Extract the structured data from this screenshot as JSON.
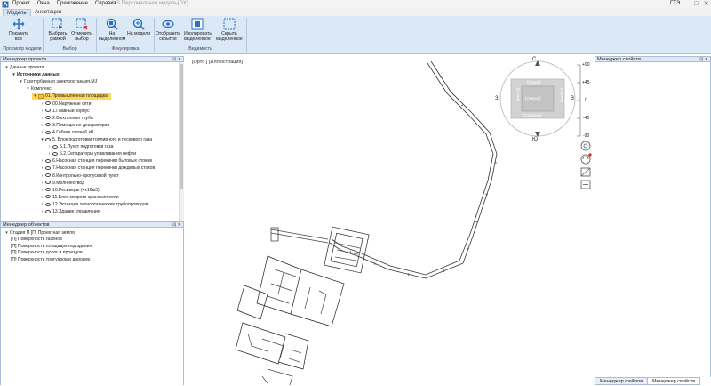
{
  "titlebar": {
    "menu": [
      "Проект",
      "Окна",
      "Приложение",
      "Справка"
    ],
    "app_title": "MS Персональная модель(DX)",
    "user": "ГТЭ",
    "min": "–",
    "max": "□",
    "close": "✕"
  },
  "ribbon_tabs": [
    "Модель",
    "Аннотации"
  ],
  "ribbon": {
    "buttons": [
      {
        "label": "Показать все",
        "icon": "show-all-icon"
      },
      {
        "label": "Выбрать рамкой",
        "icon": "select-frame-icon"
      },
      {
        "label": "Отменить выбор",
        "icon": "deselect-icon"
      },
      {
        "label": "На выделенном",
        "icon": "zoom-selected-icon"
      },
      {
        "label": "На модели",
        "icon": "zoom-model-icon"
      },
      {
        "label": "Отобразить скрытое",
        "icon": "show-hidden-icon"
      },
      {
        "label": "Изолировать выделенное",
        "icon": "isolate-icon"
      },
      {
        "label": "Скрыть выделенное",
        "icon": "hide-selected-icon"
      }
    ],
    "groups": [
      "Просмотр модели",
      "Выбор",
      "Фокусировка",
      "Видимость"
    ]
  },
  "project_manager": {
    "title": "Менеджер проекта",
    "tree": [
      {
        "label": "Данные проекта",
        "depth": 0,
        "toggle": "▾"
      },
      {
        "label": "Источники данных",
        "depth": 1,
        "toggle": "▾",
        "bold": true
      },
      {
        "label": "Газотурбинная электростанция.MJ",
        "depth": 2,
        "toggle": "▾"
      },
      {
        "label": "Комплекс",
        "depth": 3,
        "toggle": "▾"
      },
      {
        "label": "01.Промышленная площадка",
        "depth": 4,
        "toggle": "▾",
        "selected": true
      },
      {
        "label": "00.Наружные сети",
        "depth": 5,
        "toggle": "›"
      },
      {
        "label": "1.Главный корпус",
        "depth": 5,
        "toggle": "›"
      },
      {
        "label": "2.Выхлопная труба",
        "depth": 5,
        "toggle": "›"
      },
      {
        "label": "3.Помещение деаэраторов",
        "depth": 5,
        "toggle": "›"
      },
      {
        "label": "4.Гибкие связи 6 кВ",
        "depth": 5,
        "toggle": "›"
      },
      {
        "label": "5. Блок подготовки топливного и пускового газа",
        "depth": 5,
        "toggle": "▾"
      },
      {
        "label": "5.1.Пункт подготовки газа",
        "depth": 6,
        "toggle": "›"
      },
      {
        "label": "5.2.Сепараторы улавливания нефти",
        "depth": 6,
        "toggle": "›"
      },
      {
        "label": "6.Насосная станция перекачки бытовых стоков",
        "depth": 5,
        "toggle": "›"
      },
      {
        "label": "7.Насосная станция перекачки дождевых стоков",
        "depth": 5,
        "toggle": "›"
      },
      {
        "label": "8.Контрольно-пропускной пункт",
        "depth": 5,
        "toggle": "›"
      },
      {
        "label": "9.Молниеотвод",
        "depth": 5,
        "toggle": "›"
      },
      {
        "label": "10.Ресиверы (4х10м3)",
        "depth": 5,
        "toggle": "›"
      },
      {
        "label": "11.Блок мокрого хранения соли",
        "depth": 5,
        "toggle": "›"
      },
      {
        "label": "12.Эстакада технологических трубопроводов",
        "depth": 5,
        "toggle": "›"
      },
      {
        "label": "13.Здание управления",
        "depth": 5,
        "toggle": "›"
      }
    ]
  },
  "object_manager": {
    "title": "Менеджер объектов",
    "tree": [
      {
        "label": "Стадия П [П] Проектная земля",
        "depth": 0,
        "toggle": "▾"
      },
      {
        "label": "[П] Поверхность газонов",
        "depth": 1
      },
      {
        "label": "[П] Поверхность площадок под здания",
        "depth": 1
      },
      {
        "label": "[П] Поверхность дорог и проездов",
        "depth": 1
      },
      {
        "label": "[П] Поверхность тротуаров и дорожек",
        "depth": 1
      }
    ]
  },
  "viewport": {
    "view_label": "[Орто ] [Иллюстрация]",
    "compass": {
      "n": "С",
      "s": "Ю",
      "w": "З",
      "e": "В"
    },
    "viewcube": {
      "top": "[Сзади]",
      "center": "[Сверху]",
      "bottom": "[Спереди]",
      "left": "[Слева]",
      "right": "[Справа]"
    },
    "scale_labels": [
      "+90",
      "+45",
      "0",
      "-45",
      "-90"
    ]
  },
  "properties_manager": {
    "title": "Менеджер свойств"
  },
  "bottom_tabs": [
    "Менеджер файлов",
    "Менеджер свойств"
  ],
  "colors": {
    "ribbon_bg": "#dbe8f5",
    "selection": "#ffd75e",
    "panel_header": "#dfe9f5"
  }
}
